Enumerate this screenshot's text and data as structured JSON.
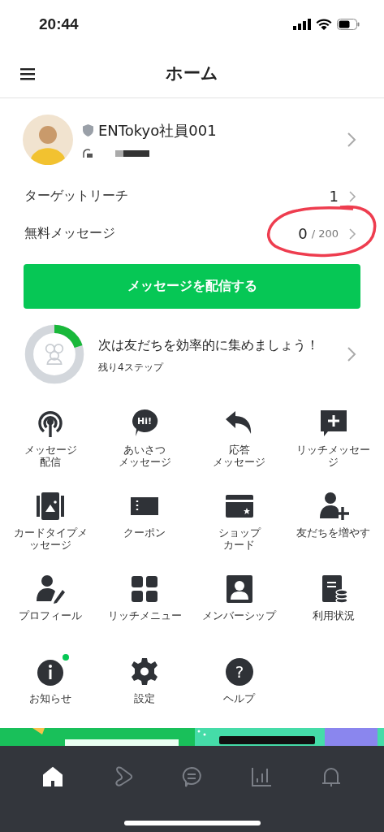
{
  "status_bar": {
    "time": "20:44"
  },
  "header": {
    "title": "ホーム"
  },
  "profile": {
    "name": "ENTokyo社員001"
  },
  "stats": [
    {
      "label": "ターゲットリーチ",
      "value": "1",
      "highlighted": false
    },
    {
      "label": "無料メッセージ",
      "value": "0",
      "total": "/ 200",
      "highlighted": true
    }
  ],
  "send_button": "メッセージを配信する",
  "progress": {
    "level": 0.2,
    "title": "次は友だちを効率的に集めましょう！",
    "subtitle": "残り4ステップ"
  },
  "menu": [
    {
      "kind": "broadcast",
      "label_lines": [
        "メッセージ",
        "配信"
      ],
      "badge": false
    },
    {
      "kind": "greeting",
      "label_lines": [
        "あいさつ",
        "メッセージ"
      ],
      "icon_text": "Hi!",
      "badge": false
    },
    {
      "kind": "reply",
      "label_lines": [
        "応答",
        "メッセージ"
      ],
      "badge": false
    },
    {
      "kind": "rich",
      "label_lines": [
        "リッチメッセー",
        "ジ"
      ],
      "badge": false
    },
    {
      "kind": "cardtype",
      "label_lines": [
        "カードタイプメ",
        "ッセージ"
      ],
      "badge": false
    },
    {
      "kind": "coupon",
      "label_lines": [
        "クーポン"
      ],
      "badge": false
    },
    {
      "kind": "shopcard",
      "label_lines": [
        "ショップ",
        "カード"
      ],
      "badge": false
    },
    {
      "kind": "addfriend",
      "label_lines": [
        "友だちを増やす"
      ],
      "badge": false
    },
    {
      "kind": "profile",
      "label_lines": [
        "プロフィール"
      ],
      "badge": false
    },
    {
      "kind": "richmenu",
      "label_lines": [
        "リッチメニュー"
      ],
      "badge": false
    },
    {
      "kind": "membership",
      "label_lines": [
        "メンバーシップ"
      ],
      "badge": false
    },
    {
      "kind": "usage",
      "label_lines": [
        "利用状況"
      ],
      "badge": false
    },
    {
      "kind": "info",
      "label_lines": [
        "お知らせ"
      ],
      "badge": true
    },
    {
      "kind": "settings",
      "label_lines": [
        "設定"
      ],
      "badge": false
    },
    {
      "kind": "help",
      "label_lines": [
        "ヘルプ"
      ],
      "icon_text": "?",
      "badge": false
    }
  ],
  "nav": [
    {
      "kind": "home",
      "selected": true
    },
    {
      "kind": "play",
      "selected": false
    },
    {
      "kind": "chat",
      "selected": false
    },
    {
      "kind": "stats",
      "selected": false
    },
    {
      "kind": "bell",
      "selected": false
    }
  ]
}
